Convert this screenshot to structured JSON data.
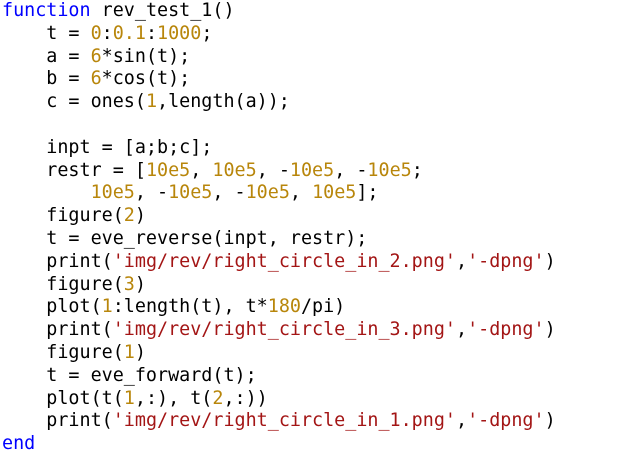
{
  "editor": {
    "lines": [
      [
        {
          "t": "kw",
          "v": "function"
        },
        {
          "t": "plain",
          "v": " rev_test_1()"
        }
      ],
      [
        {
          "t": "plain",
          "v": "    t = "
        },
        {
          "t": "num",
          "v": "0"
        },
        {
          "t": "plain",
          "v": ":"
        },
        {
          "t": "num",
          "v": "0.1"
        },
        {
          "t": "plain",
          "v": ":"
        },
        {
          "t": "num",
          "v": "1000"
        },
        {
          "t": "plain",
          "v": ";"
        }
      ],
      [
        {
          "t": "plain",
          "v": "    a = "
        },
        {
          "t": "num",
          "v": "6"
        },
        {
          "t": "plain",
          "v": "*sin(t);"
        }
      ],
      [
        {
          "t": "plain",
          "v": "    b = "
        },
        {
          "t": "num",
          "v": "6"
        },
        {
          "t": "plain",
          "v": "*cos(t);"
        }
      ],
      [
        {
          "t": "plain",
          "v": "    c = ones("
        },
        {
          "t": "num",
          "v": "1"
        },
        {
          "t": "plain",
          "v": ",length(a));"
        }
      ],
      [],
      [
        {
          "t": "plain",
          "v": "    inpt = [a;b;c];"
        }
      ],
      [
        {
          "t": "plain",
          "v": "    restr = ["
        },
        {
          "t": "num",
          "v": "10e5"
        },
        {
          "t": "plain",
          "v": ", "
        },
        {
          "t": "num",
          "v": "10e5"
        },
        {
          "t": "plain",
          "v": ", -"
        },
        {
          "t": "num",
          "v": "10e5"
        },
        {
          "t": "plain",
          "v": ", -"
        },
        {
          "t": "num",
          "v": "10e5"
        },
        {
          "t": "plain",
          "v": ";"
        }
      ],
      [
        {
          "t": "plain",
          "v": "        "
        },
        {
          "t": "num",
          "v": "10e5"
        },
        {
          "t": "plain",
          "v": ", -"
        },
        {
          "t": "num",
          "v": "10e5"
        },
        {
          "t": "plain",
          "v": ", -"
        },
        {
          "t": "num",
          "v": "10e5"
        },
        {
          "t": "plain",
          "v": ", "
        },
        {
          "t": "num",
          "v": "10e5"
        },
        {
          "t": "plain",
          "v": "];"
        }
      ],
      [
        {
          "t": "plain",
          "v": "    figure("
        },
        {
          "t": "num",
          "v": "2"
        },
        {
          "t": "plain",
          "v": ")"
        }
      ],
      [
        {
          "t": "plain",
          "v": "    t = eve_reverse(inpt, restr);"
        }
      ],
      [
        {
          "t": "plain",
          "v": "    print("
        },
        {
          "t": "str",
          "v": "'img/rev/right_circle_in_2.png'"
        },
        {
          "t": "plain",
          "v": ","
        },
        {
          "t": "str",
          "v": "'-dpng'"
        },
        {
          "t": "plain",
          "v": ")"
        }
      ],
      [
        {
          "t": "plain",
          "v": "    figure("
        },
        {
          "t": "num",
          "v": "3"
        },
        {
          "t": "plain",
          "v": ")"
        }
      ],
      [
        {
          "t": "plain",
          "v": "    plot("
        },
        {
          "t": "num",
          "v": "1"
        },
        {
          "t": "plain",
          "v": ":length(t), t*"
        },
        {
          "t": "num",
          "v": "180"
        },
        {
          "t": "plain",
          "v": "/pi)"
        }
      ],
      [
        {
          "t": "plain",
          "v": "    print("
        },
        {
          "t": "str",
          "v": "'img/rev/right_circle_in_3.png'"
        },
        {
          "t": "plain",
          "v": ","
        },
        {
          "t": "str",
          "v": "'-dpng'"
        },
        {
          "t": "plain",
          "v": ")"
        }
      ],
      [
        {
          "t": "plain",
          "v": "    figure("
        },
        {
          "t": "num",
          "v": "1"
        },
        {
          "t": "plain",
          "v": ")"
        }
      ],
      [
        {
          "t": "plain",
          "v": "    t = eve_forward(t);"
        }
      ],
      [
        {
          "t": "plain",
          "v": "    plot(t("
        },
        {
          "t": "num",
          "v": "1"
        },
        {
          "t": "plain",
          "v": ",:), t("
        },
        {
          "t": "num",
          "v": "2"
        },
        {
          "t": "plain",
          "v": ",:))"
        }
      ],
      [
        {
          "t": "plain",
          "v": "    print("
        },
        {
          "t": "str",
          "v": "'img/rev/right_circle_in_1.png'"
        },
        {
          "t": "plain",
          "v": ","
        },
        {
          "t": "str",
          "v": "'-dpng'"
        },
        {
          "t": "plain",
          "v": ")"
        }
      ],
      [
        {
          "t": "kw",
          "v": "end"
        }
      ]
    ]
  },
  "colors": {
    "keyword": "#0000ff",
    "number": "#b8860b",
    "string": "#a31515",
    "plain": "#000000",
    "background": "#ffffff"
  }
}
